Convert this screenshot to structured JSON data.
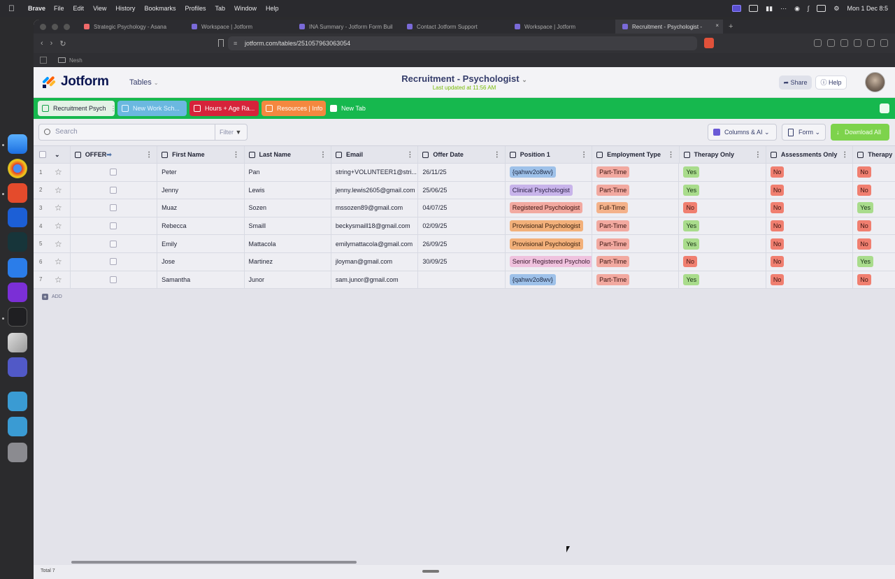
{
  "menubar": {
    "app": "Brave",
    "items": [
      "File",
      "Edit",
      "View",
      "History",
      "Bookmarks",
      "Profiles",
      "Tab",
      "Window",
      "Help"
    ],
    "clock": "Mon 1 Dec 8:5"
  },
  "browser": {
    "tabs": [
      {
        "label": "Strategic Psychology - Asana",
        "active": false,
        "color": "#f06a6a"
      },
      {
        "label": "Workspace | Jotform",
        "active": false,
        "color": "#7a6ad8"
      },
      {
        "label": "INA Summary - Jotform Form Buil",
        "active": false,
        "color": "#7a6ad8"
      },
      {
        "label": "Contact Jotform Support",
        "active": false,
        "color": "#7a6ad8"
      },
      {
        "label": "Workspace | Jotform",
        "active": false,
        "color": "#7a6ad8"
      },
      {
        "label": "Recruitment - Psychologist -",
        "active": true,
        "color": "#7a6ad8"
      }
    ],
    "url": "jotform.com/tables/251057963063054",
    "bookmark_folder": "Nesh"
  },
  "header": {
    "logo": "Jotform",
    "tables_label": "Tables",
    "title": "Recruitment - Psychologist",
    "subtitle": "Last updated at 11:56 AM",
    "share_label": "Share",
    "help_label": "Help"
  },
  "sheets": [
    {
      "label": "Recruitment Psych",
      "style": "s0"
    },
    {
      "label": "New Work Sch...",
      "style": "s1"
    },
    {
      "label": "Hours + Age Ra...",
      "style": "s2"
    },
    {
      "label": "Resources | Info",
      "style": "s3"
    },
    {
      "label": "New Tab",
      "style": "s4"
    }
  ],
  "toolbar": {
    "search_placeholder": "Search",
    "filter_label": "Filter",
    "columns_label": "Columns & AI",
    "form_label": "Form",
    "download_label": "Download All"
  },
  "columns": [
    "OFFER",
    "First Name",
    "Last Name",
    "Email",
    "Offer Date",
    "Position 1",
    "Employment Type",
    "Therapy Only",
    "Assessments Only",
    "Therapy"
  ],
  "rows": [
    {
      "n": "1",
      "first": "Peter",
      "last": "Pan",
      "email": "string+VOLUNTEER1@stri...",
      "date": "26/11/25",
      "position": "{qahwv2o8wv}",
      "pos_color": "p-teal",
      "emp": "Part-Time",
      "emp_color": "p-red",
      "therapy": "Yes",
      "assess": "No",
      "therapy2": "No"
    },
    {
      "n": "2",
      "first": "Jenny",
      "last": "Lewis",
      "email": "jenny.lewis2605@gmail.com",
      "date": "25/06/25",
      "position": "Clinical Psychologist",
      "pos_color": "p-purple",
      "emp": "Part-Time",
      "emp_color": "p-red",
      "therapy": "Yes",
      "assess": "No",
      "therapy2": "No"
    },
    {
      "n": "3",
      "first": "Muaz",
      "last": "Sozen",
      "email": "mssozen89@gmail.com",
      "date": "04/07/25",
      "position": "Registered Psychologist",
      "pos_color": "p-red",
      "emp": "Full-Time",
      "emp_color": "p-peach",
      "therapy": "No",
      "assess": "No",
      "therapy2": "Yes"
    },
    {
      "n": "4",
      "first": "Rebecca",
      "last": "Smaill",
      "email": "beckysmaill18@gmail.com",
      "date": "02/09/25",
      "position": "Provisional Psychologist",
      "pos_color": "p-orange",
      "emp": "Part-Time",
      "emp_color": "p-red",
      "therapy": "Yes",
      "assess": "No",
      "therapy2": "No"
    },
    {
      "n": "5",
      "first": "Emily",
      "last": "Mattacola",
      "email": "emilymattacola@gmail.com",
      "date": "26/09/25",
      "position": "Provisional Psychologist",
      "pos_color": "p-orange",
      "emp": "Part-Time",
      "emp_color": "p-red",
      "therapy": "Yes",
      "assess": "No",
      "therapy2": "No"
    },
    {
      "n": "6",
      "first": "Jose",
      "last": "Martinez",
      "email": "jloyman@gmail.com",
      "date": "30/09/25",
      "position": "Senior Registered Psycholo",
      "pos_color": "p-pink",
      "emp": "Part-Time",
      "emp_color": "p-red",
      "therapy": "No",
      "assess": "No",
      "therapy2": "Yes"
    },
    {
      "n": "7",
      "first": "Samantha",
      "last": "Junor",
      "email": "sam.junor@gmail.com",
      "date": "",
      "position": "{qahwv2o8wv}",
      "pos_color": "p-teal",
      "emp": "Part-Time",
      "emp_color": "p-red",
      "therapy": "Yes",
      "assess": "No",
      "therapy2": "No"
    }
  ],
  "add_label": "ADD",
  "footer_total": "Total 7"
}
